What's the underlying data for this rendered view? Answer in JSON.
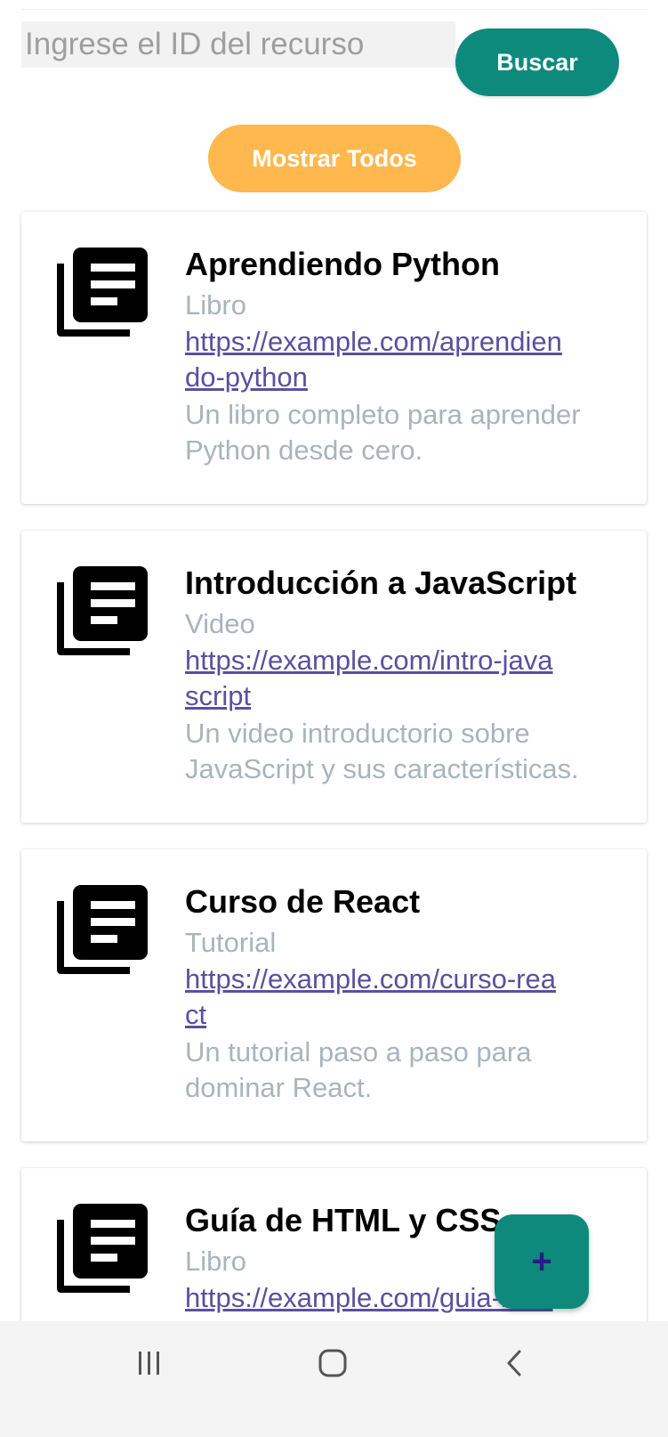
{
  "search": {
    "placeholder": "Ingrese el ID del recurso",
    "value": "",
    "button_label": "Buscar"
  },
  "show_all_label": "Mostrar Todos",
  "resources": [
    {
      "title": "Aprendiendo Python",
      "type": "Libro",
      "url": "https://example.com/aprendiendo-python",
      "description": "Un libro completo para aprender Python desde cero.",
      "icon": "library-books-icon"
    },
    {
      "title": "Introducción a JavaScript",
      "type": "Video",
      "url": "https://example.com/intro-javascript",
      "description": "Un video introductorio sobre JavaScript y sus características.",
      "icon": "library-books-icon"
    },
    {
      "title": "Curso de React",
      "type": "Tutorial",
      "url": "https://example.com/curso-react",
      "description": "Un tutorial paso a paso para dominar React.",
      "icon": "library-books-icon"
    },
    {
      "title": "Guía de HTML y CSS",
      "type": "Libro",
      "url": "https://example.com/guia-html",
      "description": "",
      "icon": "library-books-icon"
    }
  ],
  "fab_label": "+",
  "nav": {
    "recents_icon": "recents-icon",
    "home_icon": "home-icon",
    "back_icon": "back-icon"
  },
  "colors": {
    "primary": "#0e8a7d",
    "accent": "#ffb84d",
    "link": "#5c4f9e",
    "muted_text": "#a9b4bb"
  }
}
